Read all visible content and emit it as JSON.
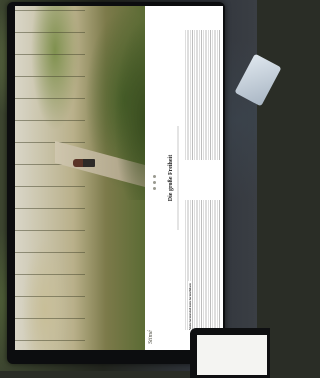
{
  "website": {
    "logo": "Stimé",
    "logo_tagline": "",
    "article_title": "Die große Freiheit",
    "section_heading": "Vom Grenzstul zum Grenzfelsen"
  },
  "hero_image": {
    "description_icon": "hiker-photo"
  },
  "colors": {
    "page_background": "#ffffff",
    "bezel": "#0c0d0f"
  }
}
